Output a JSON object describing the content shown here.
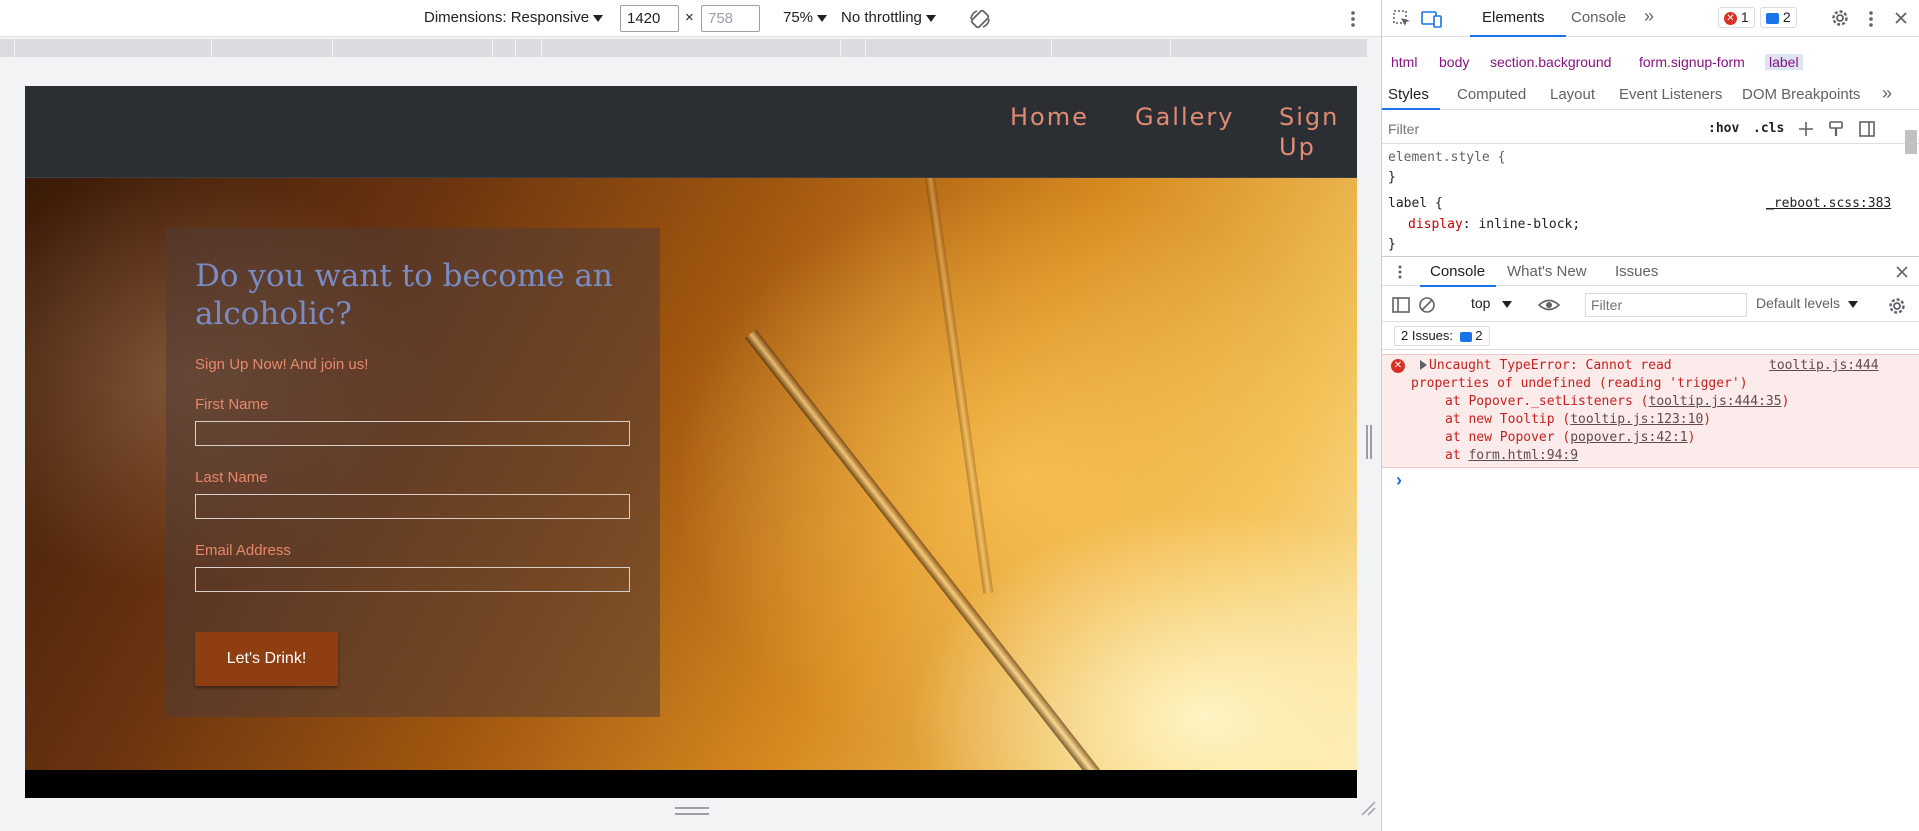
{
  "device_toolbar": {
    "dimensions_label": "Dimensions: Responsive",
    "width_value": "1420",
    "height_placeholder": "758",
    "times_sign": "×",
    "zoom": "75%",
    "throttling": "No throttling"
  },
  "site": {
    "nav": {
      "home": "Home",
      "gallery": "Gallery",
      "signup_line1": "Sign",
      "signup_line2": "Up"
    },
    "form": {
      "heading": "Do you want to become an alcoholic?",
      "subheading": "Sign Up Now! And join us!",
      "first_name_label": "First Name",
      "last_name_label": "Last Name",
      "email_label": "Email Address",
      "submit_label": "Let's Drink!"
    }
  },
  "devtools": {
    "tabs": {
      "elements": "Elements",
      "console": "Console",
      "more": "»"
    },
    "badges": {
      "errors": "1",
      "messages": "2"
    },
    "breadcrumbs": [
      "html",
      "body",
      "section.background",
      "form.signup-form",
      "label"
    ],
    "style_tabs": [
      "Styles",
      "Computed",
      "Layout",
      "Event Listeners",
      "DOM Breakpoints",
      "»"
    ],
    "filter_placeholder": "Filter",
    "hov": ":hov",
    "cls": ".cls",
    "styles": {
      "element_style_open": "element.style {",
      "element_style_close": "}",
      "label_selector": "label {",
      "label_source": "_reboot.scss:383",
      "label_prop": "display",
      "label_value": "inline-block;",
      "label_close": "}"
    },
    "drawer_tabs": [
      "Console",
      "What's New",
      "Issues"
    ],
    "console": {
      "context": "top",
      "filter_placeholder": "Filter",
      "levels": "Default levels",
      "issues_label": "2 Issues:",
      "issues_count": "2",
      "error_line1": "Uncaught TypeError: Cannot read",
      "error_source": "tooltip.js:444",
      "error_line2": "properties of undefined (reading 'trigger')",
      "stack": [
        {
          "prefix": "at Popover._setListeners (",
          "link": "tooltip.js:444:35",
          "suffix": ")"
        },
        {
          "prefix": "at new Tooltip (",
          "link": "tooltip.js:123:10",
          "suffix": ")"
        },
        {
          "prefix": "at new Popover (",
          "link": "popover.js:42:1",
          "suffix": ")"
        },
        {
          "prefix": "at ",
          "link": "form.html:94:9",
          "suffix": ""
        }
      ],
      "prompt": "›"
    }
  }
}
